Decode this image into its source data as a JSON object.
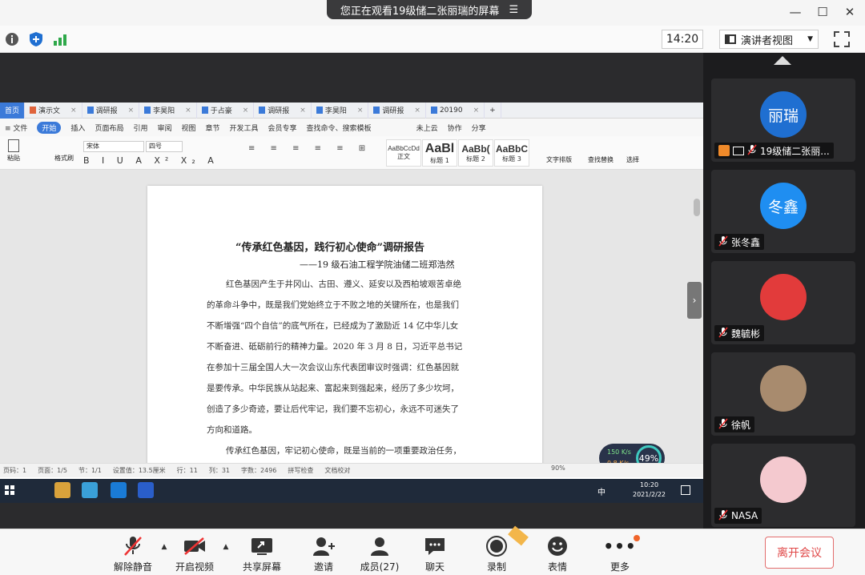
{
  "banner": {
    "text": "您正在观看19级储二张丽瑞的屏幕"
  },
  "window_controls": {
    "minimize": "—",
    "maximize": "☐",
    "close": "✕"
  },
  "info_bar": {
    "timer": "14:20",
    "view_mode": "演讲者视图"
  },
  "wps": {
    "tabs": [
      "首页",
      "演示文",
      "调研报",
      "李昊阳",
      "于占豪",
      "调研报",
      "李昊阳",
      "调研报",
      "20190",
      "+"
    ],
    "menu": [
      "≡ 文件",
      "开始",
      "插入",
      "页面布局",
      "引用",
      "审阅",
      "视图",
      "章节",
      "开发工具",
      "会员专享",
      "查找命令、搜索模板",
      "未上云",
      "协作",
      "分享"
    ],
    "ribbon": {
      "paste": "粘贴",
      "format_painter": "格式刷",
      "font_name": "宋体",
      "font_size": "四号",
      "styles": [
        {
          "preview": "AaBbCcDd",
          "label": "正文"
        },
        {
          "preview": "AaBl",
          "label": "标题 1"
        },
        {
          "preview": "AaBb(",
          "label": "标题 2"
        },
        {
          "preview": "AaBbC",
          "label": "标题 3"
        }
      ],
      "text_layout": "文字排版",
      "find_replace": "查找替换",
      "select": "选择"
    },
    "document": {
      "title": "“传承红色基因，践行初心使命”调研报告",
      "author": "——19 级石油工程学院油储二班郑浩然",
      "lines": [
        "红色基因产生于井冈山、古田、遵义、延安以及西柏坡艰苦卓绝",
        "的革命斗争中，既是我们党始终立于不败之地的关键所在，也是我们",
        "不断增强“四个自信”的底气所在，已经成为了激励近 14 亿中华儿女",
        "不断奋进、砥砺前行的精神力量。2020 年 3 月 8 日，习近平总书记",
        "在参加十三届全国人大一次会议山东代表团审议时强调：红色基因就",
        "是要传承。中华民族从站起来、富起来到强起来，经历了多少坎坷，",
        "创造了多少奇迹，要让后代牢记，我们要不忘初心，永远不可迷失了",
        "方向和道路。",
        "传承红色基因，牢记初心使命，既是当前的一项重要政治任务，"
      ]
    },
    "status_bar": [
      "页码：1",
      "页面：1/5",
      "节：1/1",
      "设置值：13.5厘米",
      "行：11",
      "列：31",
      "字数：2496",
      "拼写检查",
      "文档校对"
    ],
    "zoom": "90%",
    "speed": {
      "up": "150 K/s",
      "down": "0.8 K/s",
      "percent": "49%"
    },
    "clock": {
      "time": "10:20",
      "date": "2021/2/22",
      "lang": "中"
    }
  },
  "participants": [
    {
      "avatar_text": "丽瑞",
      "name": "19级储二张丽...",
      "avatar_color": "#1f6fd1"
    },
    {
      "avatar_text": "冬鑫",
      "name": "张冬鑫",
      "avatar_color": "#1f8ef1"
    },
    {
      "avatar_text": "",
      "name": "魏毓彬",
      "avatar_color": "#e23b3b"
    },
    {
      "avatar_text": "",
      "name": "徐帆",
      "avatar_color": "#a88b6e"
    },
    {
      "avatar_text": "",
      "name": "NASA",
      "avatar_color": "#f4c9cf"
    }
  ],
  "toolbar": {
    "mute": "解除静音",
    "video": "开启视频",
    "share": "共享屏幕",
    "invite": "邀请",
    "members": "成员(27)",
    "chat": "聊天",
    "record": "录制",
    "reactions": "表情",
    "more": "更多",
    "leave": "离开会议"
  }
}
